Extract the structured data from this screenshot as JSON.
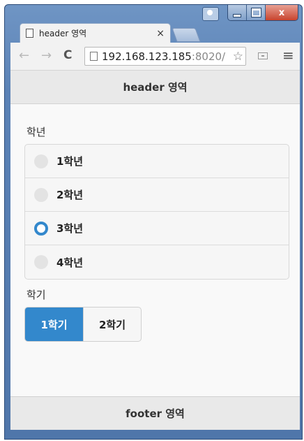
{
  "browser": {
    "tab_title": "header 영역",
    "tab_close": "×",
    "url_host": "192.168.123.185",
    "url_port": ":8020/",
    "nav_back": "←",
    "nav_forward": "→",
    "nav_reload": "C",
    "star": "☆",
    "menu": "≡",
    "close_glyph": "x",
    "icons": [
      "page-icon",
      "back-arrow-icon",
      "forward-arrow-icon",
      "reload-icon",
      "star-icon",
      "cast-icon",
      "menu-icon",
      "minimize-icon",
      "maximize-icon",
      "close-icon"
    ]
  },
  "header": {
    "title": "header 영역"
  },
  "grade": {
    "legend": "학년",
    "options": [
      {
        "label": "1학년",
        "checked": false
      },
      {
        "label": "2학년",
        "checked": false
      },
      {
        "label": "3학년",
        "checked": true
      },
      {
        "label": "4학년",
        "checked": false
      }
    ]
  },
  "semester": {
    "legend": "학기",
    "options": [
      {
        "label": "1학기",
        "active": true
      },
      {
        "label": "2학기",
        "active": false
      }
    ]
  },
  "footer": {
    "title": "footer 영역"
  },
  "colors": {
    "accent": "#3388cc",
    "window_frame": "#5b82b6",
    "bar": "#e9e9e9"
  }
}
